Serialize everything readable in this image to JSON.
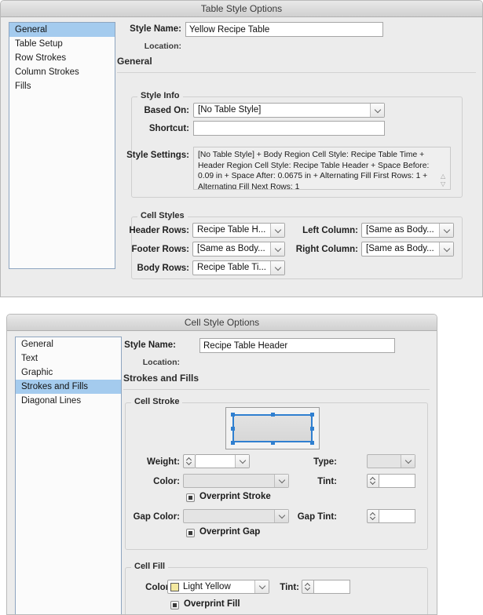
{
  "table_style_dialog": {
    "title": "Table Style Options",
    "sidebar": [
      {
        "label": "General",
        "selected": true
      },
      {
        "label": "Table Setup",
        "selected": false
      },
      {
        "label": "Row Strokes",
        "selected": false
      },
      {
        "label": "Column Strokes",
        "selected": false
      },
      {
        "label": "Fills",
        "selected": false
      }
    ],
    "style_name_label": "Style Name:",
    "style_name_value": "Yellow Recipe Table",
    "location_label": "Location:",
    "location_value": "",
    "section_heading": "General",
    "style_info": {
      "group_title": "Style Info",
      "based_on_label": "Based On:",
      "based_on_value": "[No Table Style]",
      "shortcut_label": "Shortcut:",
      "shortcut_value": "",
      "style_settings_label": "Style Settings:",
      "style_settings_value": "[No Table Style] + Body Region Cell Style: Recipe Table Time + Header Region Cell Style: Recipe Table Header + Space Before: 0.09 in + Space After: 0.0675 in + Alternating Fill First Rows: 1 + Alternating Fill Next Rows: 1"
    },
    "cell_styles": {
      "group_title": "Cell Styles",
      "header_rows_label": "Header Rows:",
      "header_rows_value": "Recipe Table H...",
      "footer_rows_label": "Footer Rows:",
      "footer_rows_value": "[Same as Body...",
      "body_rows_label": "Body Rows:",
      "body_rows_value": "Recipe Table Ti...",
      "left_column_label": "Left Column:",
      "left_column_value": "[Same as Body...",
      "right_column_label": "Right Column:",
      "right_column_value": "[Same as Body..."
    }
  },
  "cell_style_dialog": {
    "title": "Cell Style Options",
    "sidebar": [
      {
        "label": "General",
        "selected": false
      },
      {
        "label": "Text",
        "selected": false
      },
      {
        "label": "Graphic",
        "selected": false
      },
      {
        "label": "Strokes and Fills",
        "selected": true
      },
      {
        "label": "Diagonal Lines",
        "selected": false
      }
    ],
    "style_name_label": "Style Name:",
    "style_name_value": "Recipe Table Header",
    "location_label": "Location:",
    "location_value": "",
    "section_heading": "Strokes and Fills",
    "cell_stroke": {
      "group_title": "Cell Stroke",
      "weight_label": "Weight:",
      "weight_value": "",
      "type_label": "Type:",
      "type_value": "",
      "color_label": "Color:",
      "color_value": "",
      "tint_label": "Tint:",
      "tint_value": "",
      "overprint_stroke_label": "Overprint Stroke",
      "gap_color_label": "Gap Color:",
      "gap_color_value": "",
      "gap_tint_label": "Gap Tint:",
      "gap_tint_value": "",
      "overprint_gap_label": "Overprint Gap"
    },
    "cell_fill": {
      "group_title": "Cell Fill",
      "color_label": "Color:",
      "color_value": "Light Yellow",
      "color_swatch": "#f4e9a0",
      "tint_label": "Tint:",
      "tint_value": "",
      "overprint_fill_label": "Overprint Fill"
    }
  },
  "theme": {
    "selection_blue": "#a4cbee",
    "proxy_stroke_blue": "#2f7fd0",
    "window_bg": "#ececec"
  }
}
